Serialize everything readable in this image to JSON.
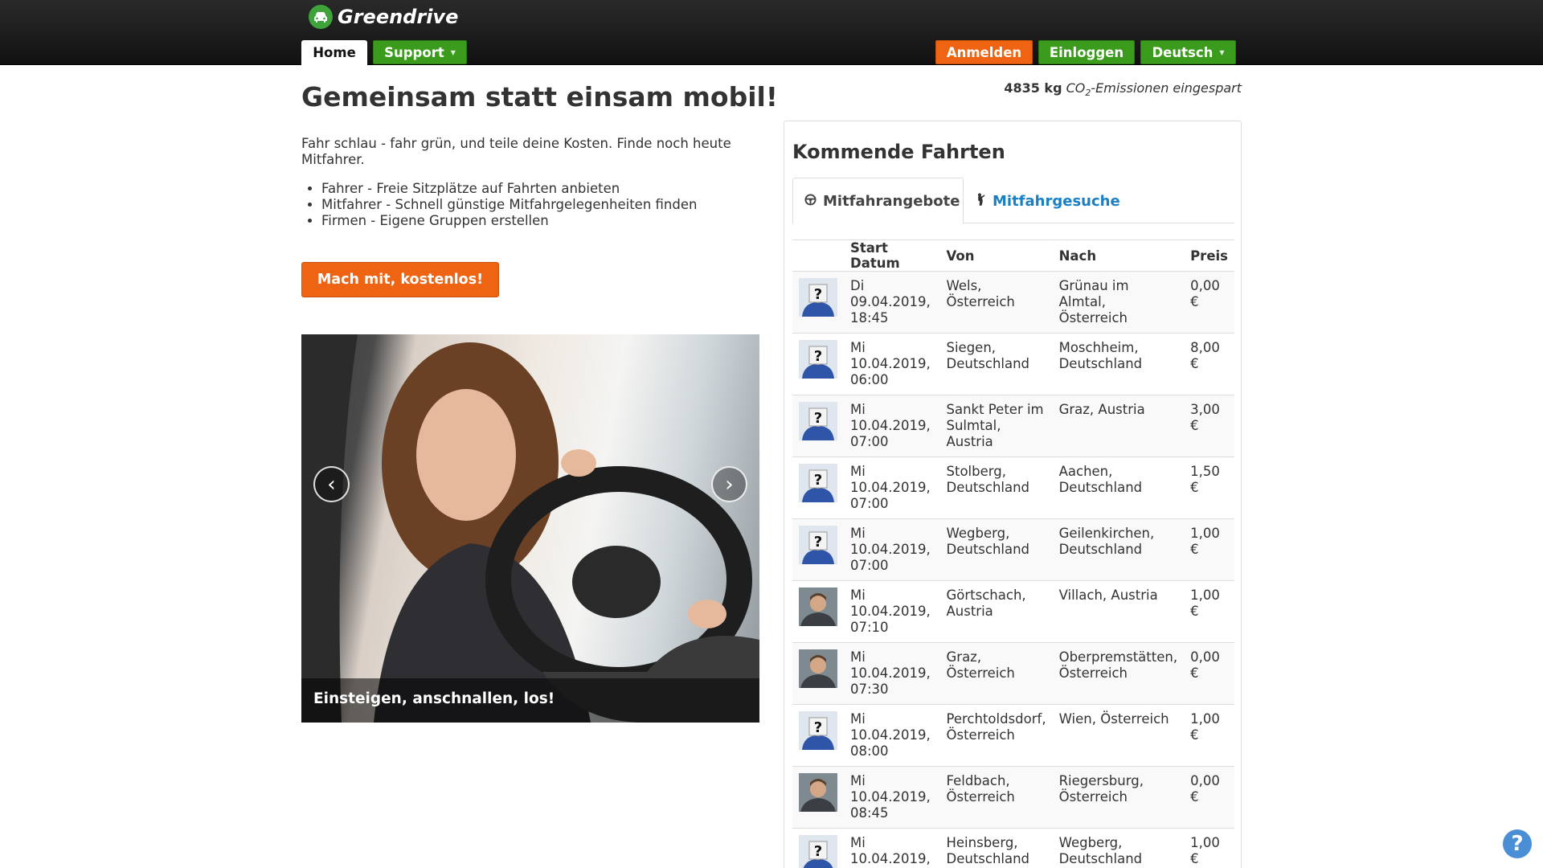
{
  "brand": {
    "name": "Greendrive"
  },
  "nav": {
    "home": "Home",
    "support": "Support",
    "register": "Anmelden",
    "login": "Einloggen",
    "language": "Deutsch"
  },
  "hero": {
    "headline": "Gemeinsam statt einsam mobil!",
    "co2_value": "4835 kg",
    "co2_prefix": "CO",
    "co2_sub": "2",
    "co2_suffix": "-Emissionen eingespart",
    "intro": "Fahr schlau - fahr grün, und teile deine Kosten. Finde noch heute Mitfahrer.",
    "bullets": [
      "Fahrer - Freie Sitzplätze auf Fahrten anbieten",
      "Mitfahrer - Schnell günstige Mitfahrgelegenheiten finden",
      "Firmen - Eigene Gruppen erstellen"
    ],
    "cta": "Mach mit, kostenlos!",
    "carousel_caption": "Einsteigen, anschnallen, los!"
  },
  "rides_panel": {
    "title": "Kommende Fahrten",
    "tab_offers": "Mitfahrangebote",
    "tab_requests": "Mitfahrgesuche",
    "headers": {
      "date": "Start Datum",
      "from": "Von",
      "to": "Nach",
      "price": "Preis"
    },
    "rows": [
      {
        "avatar": "placeholder",
        "date": "Di 09.04.2019, 18:45",
        "from": "Wels, Österreich",
        "to": "Grünau im Almtal, Österreich",
        "price": "0,00 €"
      },
      {
        "avatar": "placeholder",
        "date": "Mi 10.04.2019, 06:00",
        "from": "Siegen, Deutschland",
        "to": "Moschheim, Deutschland",
        "price": "8,00 €"
      },
      {
        "avatar": "placeholder",
        "date": "Mi 10.04.2019, 07:00",
        "from": "Sankt Peter im Sulmtal, Austria",
        "to": "Graz, Austria",
        "price": "3,00 €"
      },
      {
        "avatar": "placeholder",
        "date": "Mi 10.04.2019, 07:00",
        "from": "Stolberg, Deutschland",
        "to": "Aachen, Deutschland",
        "price": "1,50 €"
      },
      {
        "avatar": "placeholder",
        "date": "Mi 10.04.2019, 07:00",
        "from": "Wegberg, Deutschland",
        "to": "Geilenkirchen, Deutschland",
        "price": "1,00 €"
      },
      {
        "avatar": "photo",
        "date": "Mi 10.04.2019, 07:10",
        "from": "Görtschach, Austria",
        "to": "Villach, Austria",
        "price": "1,00 €"
      },
      {
        "avatar": "photo",
        "date": "Mi 10.04.2019, 07:30",
        "from": "Graz, Österreich",
        "to": "Oberpremstätten, Österreich",
        "price": "0,00 €"
      },
      {
        "avatar": "placeholder",
        "date": "Mi 10.04.2019, 08:00",
        "from": "Perchtoldsdorf, Österreich",
        "to": "Wien, Österreich",
        "price": "1,00 €"
      },
      {
        "avatar": "photo",
        "date": "Mi 10.04.2019, 08:45",
        "from": "Feldbach, Österreich",
        "to": "Riegersburg, Österreich",
        "price": "0,00 €"
      },
      {
        "avatar": "placeholder",
        "date": "Mi 10.04.2019,",
        "from": "Heinsberg, Deutschland",
        "to": "Wegberg, Deutschland",
        "price": "1,00 €"
      }
    ]
  },
  "help": {
    "label": "?"
  },
  "colors": {
    "green": "#3b9b1c",
    "orange": "#ef6413",
    "link_blue": "#1a80c4"
  },
  "icons": {
    "logo": "car-icon",
    "offers": "steering-wheel-icon",
    "requests": "hitchhiker-icon"
  }
}
